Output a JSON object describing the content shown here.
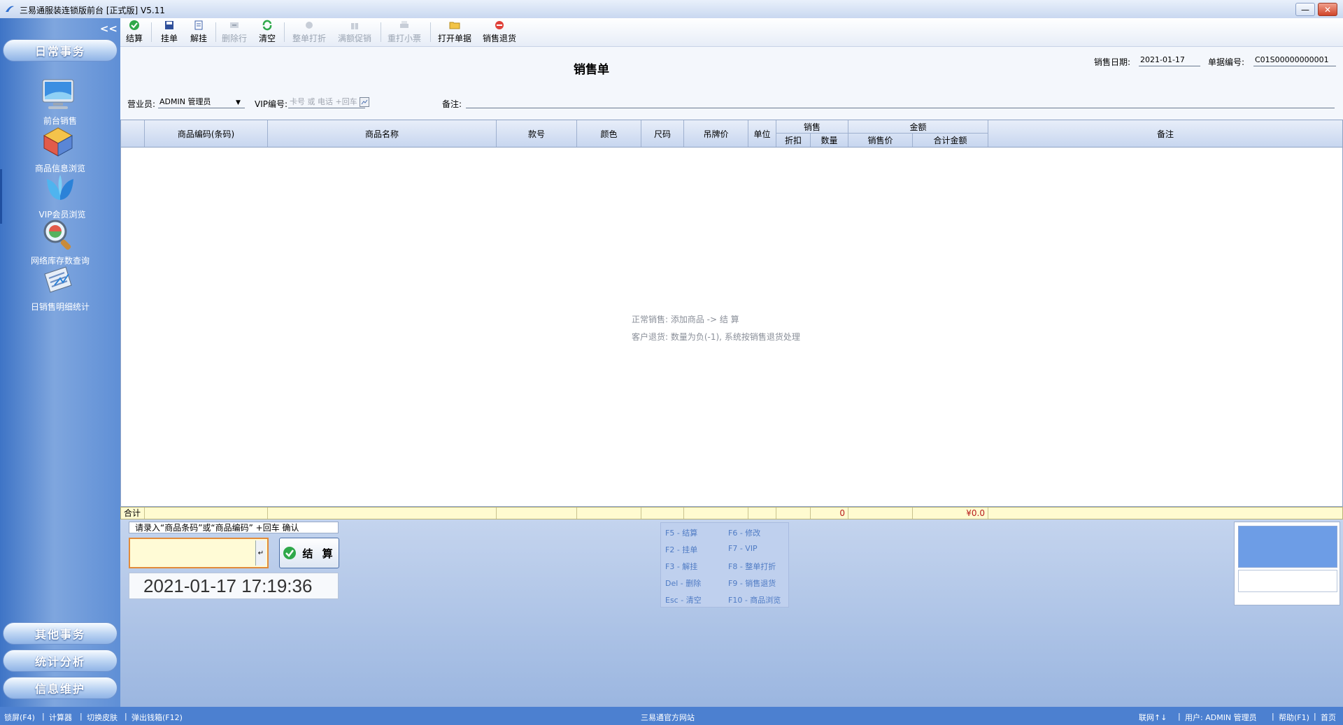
{
  "window": {
    "title": "三易通服装连锁版前台 [正式版] V5.11",
    "min": "—",
    "close": "✕"
  },
  "sidebar": {
    "collapse": "<<",
    "top_group": "日常事务",
    "items": [
      {
        "label": "前台销售",
        "icon": "monitor-icon"
      },
      {
        "label": "商品信息浏览",
        "icon": "product-cube-icon"
      },
      {
        "label": "VIP会员浏览",
        "icon": "vip-butterfly-icon"
      },
      {
        "label": "网络库存数查询",
        "icon": "magnifier-icon"
      },
      {
        "label": "日销售明细统计",
        "icon": "report-icon"
      }
    ],
    "bottom_groups": [
      "其他事务",
      "统计分析",
      "信息维护"
    ]
  },
  "toolbar": {
    "checkout": "结算",
    "hold": "挂单",
    "unhold": "解挂",
    "delete_row": "删除行",
    "clear": "清空",
    "order_discount": "整单打折",
    "promo": "满额促销",
    "reprint": "重打小票",
    "open_doc": "打开单据",
    "return": "销售退货"
  },
  "form": {
    "title": "销售单",
    "date_label": "销售日期:",
    "date_value": "2021-01-17",
    "docno_label": "单据编号:",
    "docno_value": "C01S00000000001",
    "clerk_label": "营业员:",
    "clerk_value": "ADMIN 管理员",
    "vip_label": "VIP编号:",
    "vip_placeholder": "卡号 或 电话 +回车",
    "remark_label": "备注:"
  },
  "grid": {
    "headers": {
      "code": "商品编码(条码)",
      "name": "商品名称",
      "style": "款号",
      "color": "颜色",
      "size": "尺码",
      "tag_price": "吊牌价",
      "unit": "单位",
      "sales": "销售",
      "discount": "折扣",
      "qty": "数量",
      "amount": "金额",
      "sale_price": "销售价",
      "total": "合计金额",
      "remark": "备注"
    },
    "hint1": "正常销售: 添加商品 -> 结 算",
    "hint2": "客户退货: 数量为负(-1), 系统按销售退货处理",
    "sum_label": "合计",
    "sum_qty": "0",
    "sum_total": "¥0.0"
  },
  "bottom": {
    "prompt": "请录入“商品条码”或“商品编码” +回车 确认",
    "pay_button": "结 算",
    "clock": "2021-01-17 17:19:36",
    "shortcuts": [
      "F5 - 结算",
      "F6 - 修改",
      "F2 - 挂单",
      "F7 - VIP",
      "F3 - 解挂",
      "F8 - 整单打折",
      "Del - 删除",
      "F9 - 销售退货",
      "Esc - 清空",
      "F10 - 商品浏览"
    ]
  },
  "statusbar": {
    "lock": "锁屏(F4)",
    "calc": "计算器",
    "skin": "切换皮肤",
    "drawer": "弹出钱箱(F12)",
    "site": "三易通官方网站",
    "net": "联网↑↓",
    "user": "用户: ADMIN 管理员",
    "help": "帮助(F1)",
    "home": "首页"
  },
  "colors": {
    "sidebar": "#5f8fd6",
    "statusbar": "#4c80d0",
    "sum_row": "#fffbd0",
    "accent": "#2f6fd0"
  }
}
